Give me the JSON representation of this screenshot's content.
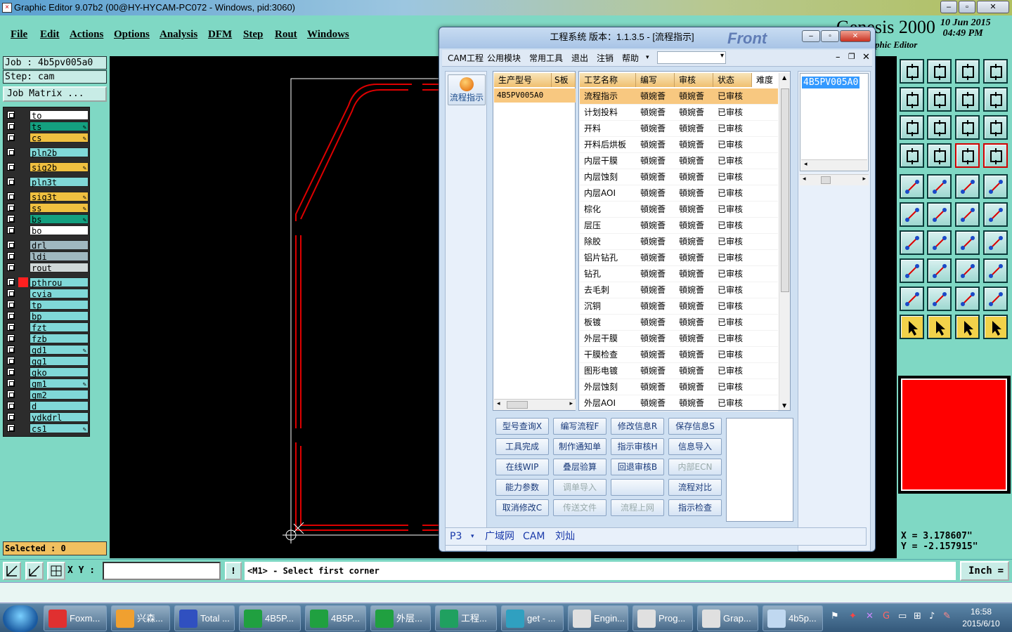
{
  "window": {
    "title": "Graphic Editor 9.07b2 (00@HY-HYCAM-PC072 - Windows, pid:3060)"
  },
  "menu": [
    "File",
    "Edit",
    "Actions",
    "Options",
    "Analysis",
    "DFM",
    "Step",
    "Rout",
    "Windows"
  ],
  "genesis": {
    "logo": "Genesis 2000",
    "subtitle": "phic Editor",
    "date": "10 Jun 2015",
    "time": "04:49 PM"
  },
  "job": {
    "job_label": "Job : 4b5pv005a0",
    "step_label": "Step: cam",
    "matrix_button": "Job Matrix ..."
  },
  "layers": [
    {
      "name": "to",
      "color": "#ffffff",
      "edit": false
    },
    {
      "name": "ts",
      "color": "#14a080",
      "edit": true
    },
    {
      "name": "cs",
      "color": "#f0c040",
      "edit": true
    },
    {
      "name": "pln2b",
      "color": "#80d8d8",
      "edit": false
    },
    {
      "name": "sig2b",
      "color": "#f0c040",
      "edit": true
    },
    {
      "name": "pln3t",
      "color": "#80d8d8",
      "edit": false
    },
    {
      "name": "sig3t",
      "color": "#f0c040",
      "edit": true
    },
    {
      "name": "ss",
      "color": "#f0c040",
      "edit": true
    },
    {
      "name": "bs",
      "color": "#14a080",
      "edit": true
    },
    {
      "name": "bo",
      "color": "#ffffff",
      "edit": false
    },
    {
      "name": "drl",
      "color": "#a0b8c0",
      "edit": false
    },
    {
      "name": "ldi",
      "color": "#a0b8c0",
      "edit": false
    },
    {
      "name": "rout",
      "color": "#d0d8d8",
      "edit": false
    },
    {
      "name": "pthrou",
      "color": "#80d8d8",
      "edit": false
    },
    {
      "name": "cvia",
      "color": "#80d8d8",
      "edit": false
    },
    {
      "name": "tp",
      "color": "#80d8d8",
      "edit": false
    },
    {
      "name": "bp",
      "color": "#80d8d8",
      "edit": false
    },
    {
      "name": "fzt",
      "color": "#80d8d8",
      "edit": false
    },
    {
      "name": "fzb",
      "color": "#80d8d8",
      "edit": false
    },
    {
      "name": "gd1",
      "color": "#80d8d8",
      "edit": true
    },
    {
      "name": "gg1",
      "color": "#80d8d8",
      "edit": false
    },
    {
      "name": "gko",
      "color": "#80d8d8",
      "edit": false
    },
    {
      "name": "gm1",
      "color": "#80d8d8",
      "edit": true
    },
    {
      "name": "gm2",
      "color": "#80d8d8",
      "edit": false
    },
    {
      "name": "d",
      "color": "#80d8d8",
      "edit": false
    },
    {
      "name": "ydkdrl",
      "color": "#80d8d8",
      "edit": false
    },
    {
      "name": "cs1",
      "color": "#80d8d8",
      "edit": true
    }
  ],
  "selected_label": "Selected : 0",
  "coords": {
    "x": "X = 3.178607\"",
    "y": "Y = -2.157915\""
  },
  "command": {
    "xy_label": "X Y :",
    "prompt": "<M1> - Select first corner",
    "units": "Inch"
  },
  "dialog": {
    "title": "工程系统  版本：1.1.3.5 - [流程指示]",
    "watermark": "Front",
    "menu": [
      "CAM工程",
      "公用模块",
      "常用工具",
      "退出",
      "注销",
      "帮助"
    ],
    "flow_button": "流程指示",
    "model_headers": [
      "生产型号",
      "S板"
    ],
    "model_selected": "4B5PV005A0",
    "process_headers": [
      "工艺名称",
      "编写",
      "审核",
      "状态",
      "难度"
    ],
    "processes": [
      {
        "name": "流程指示",
        "writer": "頓婉薈",
        "reviewer": "頓婉薈",
        "status": "已审核"
      },
      {
        "name": "计划投料",
        "writer": "頓婉薈",
        "reviewer": "頓婉薈",
        "status": "已审核"
      },
      {
        "name": "开料",
        "writer": "頓婉薈",
        "reviewer": "頓婉薈",
        "status": "已审核"
      },
      {
        "name": "开料后烘板",
        "writer": "頓婉薈",
        "reviewer": "頓婉薈",
        "status": "已审核"
      },
      {
        "name": "内层干膜",
        "writer": "頓婉薈",
        "reviewer": "頓婉薈",
        "status": "已审核"
      },
      {
        "name": "内层蚀刻",
        "writer": "頓婉薈",
        "reviewer": "頓婉薈",
        "status": "已审核"
      },
      {
        "name": "内层AOI",
        "writer": "頓婉薈",
        "reviewer": "頓婉薈",
        "status": "已审核"
      },
      {
        "name": "棕化",
        "writer": "頓婉薈",
        "reviewer": "頓婉薈",
        "status": "已审核"
      },
      {
        "name": "层压",
        "writer": "頓婉薈",
        "reviewer": "頓婉薈",
        "status": "已审核"
      },
      {
        "name": "除胶",
        "writer": "頓婉薈",
        "reviewer": "頓婉薈",
        "status": "已审核"
      },
      {
        "name": "铝片钻孔",
        "writer": "頓婉薈",
        "reviewer": "頓婉薈",
        "status": "已审核"
      },
      {
        "name": "钻孔",
        "writer": "頓婉薈",
        "reviewer": "頓婉薈",
        "status": "已审核"
      },
      {
        "name": "去毛刺",
        "writer": "頓婉薈",
        "reviewer": "頓婉薈",
        "status": "已审核"
      },
      {
        "name": "沉铜",
        "writer": "頓婉薈",
        "reviewer": "頓婉薈",
        "status": "已审核"
      },
      {
        "name": "板镀",
        "writer": "頓婉薈",
        "reviewer": "頓婉薈",
        "status": "已审核"
      },
      {
        "name": "外层干膜",
        "writer": "頓婉薈",
        "reviewer": "頓婉薈",
        "status": "已审核"
      },
      {
        "name": "干膜检查",
        "writer": "頓婉薈",
        "reviewer": "頓婉薈",
        "status": "已审核"
      },
      {
        "name": "图形电镀",
        "writer": "頓婉薈",
        "reviewer": "頓婉薈",
        "status": "已审核"
      },
      {
        "name": "外层蚀刻",
        "writer": "頓婉薈",
        "reviewer": "頓婉薈",
        "status": "已审核"
      },
      {
        "name": "外层AOI",
        "writer": "頓婉薈",
        "reviewer": "頓婉薈",
        "status": "已审核"
      }
    ],
    "right_value": "4B5PV005A0",
    "buttons": [
      [
        "型号查询X",
        "编写流程F",
        "修改信息R",
        "保存信息S"
      ],
      [
        "工具完成",
        "制作通知单",
        "指示审核H",
        "信息导入"
      ],
      [
        "在线WIP",
        "叠层验算",
        "回退审核B",
        "内部ECN"
      ],
      [
        "能力参数",
        "调单导入",
        "",
        "流程对比"
      ],
      [
        "取消修改C",
        "传送文件",
        "流程上网",
        "指示检查"
      ]
    ],
    "status": {
      "site": "P3",
      "net": "广域网",
      "dept": "CAM",
      "user": "刘灿"
    }
  },
  "taskbar": [
    {
      "label": "Foxm...",
      "color": "#e03030"
    },
    {
      "label": "兴森...",
      "color": "#f0a030"
    },
    {
      "label": "Total ...",
      "color": "#3050c0"
    },
    {
      "label": "4B5P...",
      "color": "#20a040"
    },
    {
      "label": "4B5P...",
      "color": "#20a040"
    },
    {
      "label": "外层...",
      "color": "#20a040"
    },
    {
      "label": "工程...",
      "color": "#20a060"
    },
    {
      "label": "get - ...",
      "color": "#30a0c0"
    },
    {
      "label": "Engin...",
      "color": "#e0e0e0"
    },
    {
      "label": "Prog...",
      "color": "#e0e0e0"
    },
    {
      "label": "Grap...",
      "color": "#e0e0e0"
    },
    {
      "label": "4b5p...",
      "color": "#c0d8f0"
    }
  ],
  "clock": {
    "time": "16:58",
    "date": "2015/6/10"
  }
}
